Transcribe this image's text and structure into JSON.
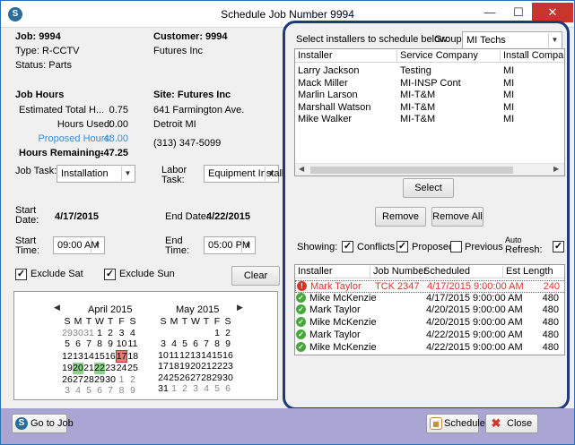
{
  "window": {
    "title": "Schedule Job Number 9994",
    "app_icon": "S"
  },
  "job": {
    "job_label": "Job: 9994",
    "type": "Type: R-CCTV",
    "status": "Status: Parts",
    "customer_label": "Customer: 9994",
    "customer_name": "Futures  Inc"
  },
  "hours": {
    "section_label": "Job Hours",
    "estimated_label": "Estimated Total H...",
    "estimated_value": "0.75",
    "used_label": "Hours Used:",
    "used_value": "0.00",
    "proposed_label": "Proposed Hours:",
    "proposed_value": "48.00",
    "remaining_label": "Hours Remaining:",
    "remaining_value": "-47.25"
  },
  "site": {
    "site_label": "Site: Futures  Inc",
    "address1": "641 Farmington Ave.",
    "address2": "Detroit MI",
    "phone": "(313) 347-5099"
  },
  "task": {
    "job_task_label": "Job Task:",
    "job_task_value": "Installation",
    "labor_task_label_1": "Labor",
    "labor_task_label_2": "Task:",
    "labor_task_value": "Equipment Install"
  },
  "dates": {
    "start_date_label_1": "Start",
    "start_date_label_2": "Date:",
    "start_date_value": "4/17/2015",
    "end_date_label": "End Date:",
    "end_date_value": "4/22/2015",
    "start_time_label_1": "Start",
    "start_time_label_2": "Time:",
    "start_time_value": "09:00 AM",
    "end_time_label_1": "End",
    "end_time_label_2": "Time:",
    "end_time_value": "05:00 PM"
  },
  "options": {
    "exclude_sat": "Exclude Sat",
    "exclude_sun": "Exclude Sun",
    "clear_button": "Clear"
  },
  "calendar": {
    "day_headers": [
      "S",
      "M",
      "T",
      "W",
      "T",
      "F",
      "S"
    ],
    "april": {
      "title": "April 2015",
      "weeks": [
        [
          "29",
          "30",
          "31",
          "1",
          "2",
          "3",
          "4"
        ],
        [
          "5",
          "6",
          "7",
          "8",
          "9",
          "10",
          "11"
        ],
        [
          "12",
          "13",
          "14",
          "15",
          "16",
          "17",
          "18"
        ],
        [
          "19",
          "20",
          "21",
          "22",
          "23",
          "24",
          "25"
        ],
        [
          "26",
          "27",
          "28",
          "29",
          "30",
          "1",
          "2"
        ],
        [
          "3",
          "4",
          "5",
          "6",
          "7",
          "8",
          "9"
        ]
      ]
    },
    "may": {
      "title": "May 2015",
      "weeks": [
        [
          "",
          "",
          "",
          "",
          "",
          "1",
          "2"
        ],
        [
          "3",
          "4",
          "5",
          "6",
          "7",
          "8",
          "9"
        ],
        [
          "10",
          "11",
          "12",
          "13",
          "14",
          "15",
          "16"
        ],
        [
          "17",
          "18",
          "19",
          "20",
          "21",
          "22",
          "23"
        ],
        [
          "24",
          "25",
          "26",
          "27",
          "28",
          "29",
          "30"
        ],
        [
          "31",
          "1",
          "2",
          "3",
          "4",
          "5",
          "6"
        ]
      ]
    }
  },
  "installers": {
    "instruction": "Select installers to schedule below:",
    "group_label": "Group:",
    "group_value": "MI Techs",
    "columns": [
      "Installer",
      "Service Company",
      "Install Company"
    ],
    "rows": [
      [
        "Larry Jackson",
        "Testing",
        "MI"
      ],
      [
        "Mack Miller",
        "MI-INSP Cont",
        "MI"
      ],
      [
        "Marlin Larson",
        "MI-T&M",
        "MI"
      ],
      [
        "Marshall Watson",
        "MI-T&M",
        "MI"
      ],
      [
        "Mike Walker",
        "MI-T&M",
        "MI"
      ]
    ],
    "select_button": "Select",
    "remove_button": "Remove",
    "remove_all_button": "Remove All"
  },
  "showing": {
    "label": "Showing:",
    "conflicts": "Conflicts",
    "proposed": "Proposed",
    "previous": "Previous",
    "auto_refresh_1": "Auto",
    "auto_refresh_2": "Refresh:"
  },
  "schedule": {
    "columns": [
      "Installer",
      "Job Number",
      "Scheduled",
      "Est Length"
    ],
    "rows": [
      {
        "status": "conflict",
        "icon": "!",
        "installer": "Mark Taylor",
        "job": "TCK 2347",
        "scheduled": "4/17/2015 9:00:00 AM",
        "length": "240"
      },
      {
        "status": "ok",
        "icon": "✓",
        "installer": "Mike McKenzie",
        "job": "",
        "scheduled": "4/17/2015 9:00:00 AM",
        "length": "480"
      },
      {
        "status": "ok",
        "icon": "✓",
        "installer": "Mark Taylor",
        "job": "",
        "scheduled": "4/20/2015 9:00:00 AM",
        "length": "480"
      },
      {
        "status": "ok",
        "icon": "✓",
        "installer": "Mike McKenzie",
        "job": "",
        "scheduled": "4/20/2015 9:00:00 AM",
        "length": "480"
      },
      {
        "status": "ok",
        "icon": "✓",
        "installer": "Mark Taylor",
        "job": "",
        "scheduled": "4/22/2015 9:00:00 AM",
        "length": "480"
      },
      {
        "status": "ok",
        "icon": "✓",
        "installer": "Mike McKenzie",
        "job": "",
        "scheduled": "4/22/2015 9:00:00 AM",
        "length": "480"
      }
    ]
  },
  "footer": {
    "go_to_job": "Go to Job",
    "schedule": "Schedule",
    "close": "Close"
  },
  "colors": {
    "panel_border": "#1e3a78",
    "footer_bg": "#a9a6d4",
    "conflict_red": "#d9342b",
    "ok_green": "#46a83a",
    "proposed_blue": "#3a8fd8"
  }
}
